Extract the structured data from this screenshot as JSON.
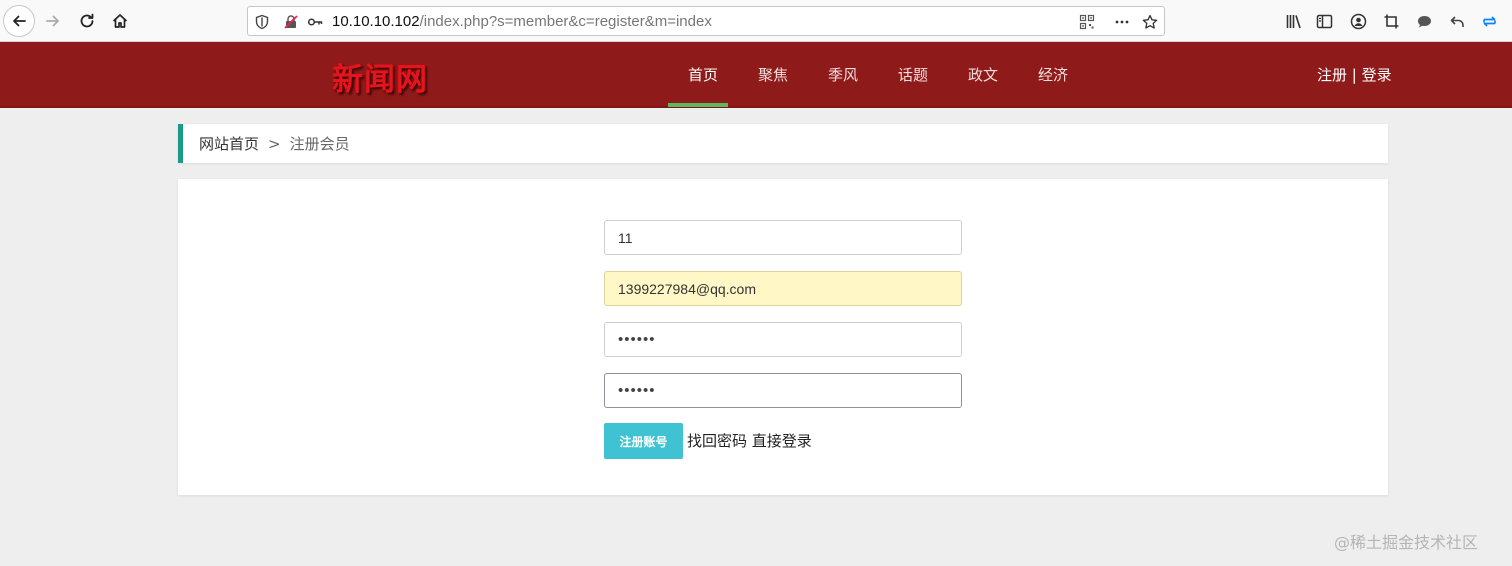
{
  "browser": {
    "url_host": "10.10.10.102",
    "url_path": "/index.php?s=member&c=register&m=index"
  },
  "site": {
    "logo": "新闻网",
    "nav": [
      {
        "label": "首页",
        "active": true
      },
      {
        "label": "聚焦"
      },
      {
        "label": "季风"
      },
      {
        "label": "话题"
      },
      {
        "label": "政文"
      },
      {
        "label": "经济"
      }
    ],
    "register_link": "注册",
    "separator": "|",
    "login_link": "登录"
  },
  "breadcrumb": {
    "home": "网站首页",
    "sep": ">",
    "current": "注册会员"
  },
  "form": {
    "username_value": "11",
    "email_value": "1399227984@qq.com",
    "password_value": "••••••",
    "confirm_password_value": "••••••",
    "submit_label": "注册账号",
    "find_password_link": "找回密码",
    "direct_login_link": "直接登录"
  },
  "watermark": "@稀土掘金技术社区",
  "colors": {
    "header_bg": "#8f1a1a",
    "logo": "#e8141d",
    "nav_active_underline": "#5cb85c",
    "breadcrumb_accent": "#1b9a8a",
    "submit_bg": "#3fc3d3",
    "autofill_bg": "#fff8c6"
  }
}
